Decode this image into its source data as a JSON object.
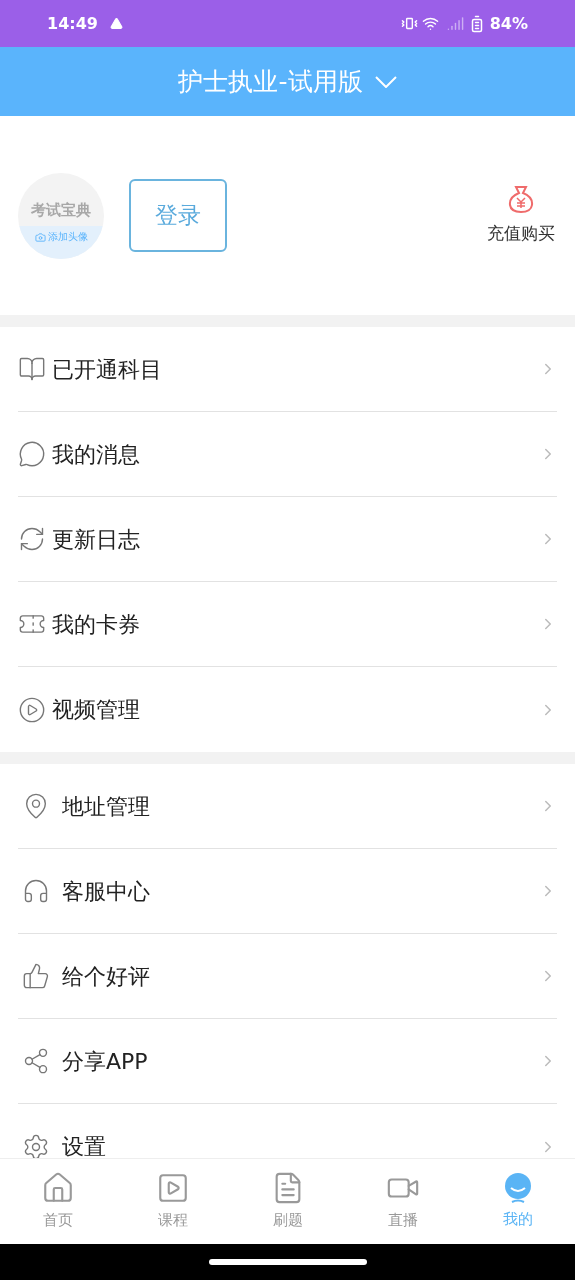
{
  "status_bar": {
    "time": "14:49",
    "battery": "84%"
  },
  "header": {
    "title": "护士执业-试用版"
  },
  "profile": {
    "avatar_text": "考试宝典",
    "avatar_caption": "添加头像",
    "login_button": "登录",
    "recharge": "充值购买"
  },
  "menu_groups": [
    {
      "items": [
        {
          "label": "已开通科目"
        },
        {
          "label": "我的消息"
        },
        {
          "label": "更新日志"
        },
        {
          "label": "我的卡券"
        },
        {
          "label": "视频管理"
        }
      ]
    },
    {
      "items": [
        {
          "label": "地址管理"
        },
        {
          "label": "客服中心"
        },
        {
          "label": "给个好评"
        },
        {
          "label": "分享APP"
        },
        {
          "label": "设置"
        }
      ]
    }
  ],
  "bottom_nav": [
    {
      "label": "首页",
      "selected": false
    },
    {
      "label": "课程",
      "selected": false
    },
    {
      "label": "刷题",
      "selected": false
    },
    {
      "label": "直播",
      "selected": false
    },
    {
      "label": "我的",
      "selected": true
    }
  ]
}
